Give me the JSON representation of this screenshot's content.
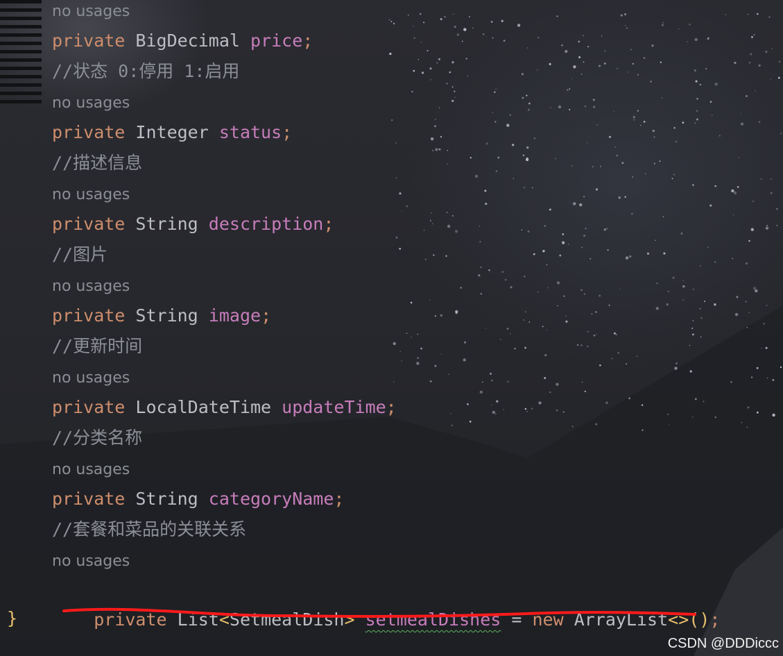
{
  "editor": {
    "lines": [
      {
        "kind": "usage",
        "text": "no usages"
      },
      {
        "kind": "code",
        "keyword": "private",
        "type": "BigDecimal",
        "name": "price",
        "end": ";"
      },
      {
        "kind": "comment",
        "text": "//状态 0:停用 1:启用"
      },
      {
        "kind": "usage",
        "text": "no usages"
      },
      {
        "kind": "code",
        "keyword": "private",
        "type": "Integer",
        "name": "status",
        "end": ";"
      },
      {
        "kind": "comment",
        "text": "//描述信息"
      },
      {
        "kind": "usage",
        "text": "no usages"
      },
      {
        "kind": "code",
        "keyword": "private",
        "type": "String",
        "name": "description",
        "end": ";"
      },
      {
        "kind": "comment",
        "text": "//图片"
      },
      {
        "kind": "usage",
        "text": "no usages"
      },
      {
        "kind": "code",
        "keyword": "private",
        "type": "String",
        "name": "image",
        "end": ";"
      },
      {
        "kind": "comment",
        "text": "//更新时间"
      },
      {
        "kind": "usage",
        "text": "no usages"
      },
      {
        "kind": "code",
        "keyword": "private",
        "type": "LocalDateTime",
        "name": "updateTime",
        "end": ";"
      },
      {
        "kind": "comment",
        "text": "//分类名称"
      },
      {
        "kind": "usage",
        "text": "no usages"
      },
      {
        "kind": "code",
        "keyword": "private",
        "type": "String",
        "name": "categoryName",
        "end": ";"
      },
      {
        "kind": "comment",
        "text": "//套餐和菜品的关联关系"
      },
      {
        "kind": "usage",
        "text": "no usages"
      }
    ],
    "last_line": {
      "keyword": "private",
      "type": "List",
      "generic_open": "<",
      "generic": "SetmealDish",
      "generic_close": ">",
      "name": "setmealDishes",
      "assign": "=",
      "new_keyword": "new",
      "ctor": "ArrayList",
      "diamond": "<>",
      "parens": "()",
      "end": ";"
    },
    "closing_brace": "}"
  },
  "annotation": {
    "underline_color": "#ff1a1a"
  },
  "watermark": {
    "text": "CSDN @DDDiccc"
  },
  "colors": {
    "keyword": "#cf8e6d",
    "field": "#c77dbb",
    "comment": "#8c8f96",
    "type": "#bcbec4",
    "brace": "#e8bf6a"
  }
}
